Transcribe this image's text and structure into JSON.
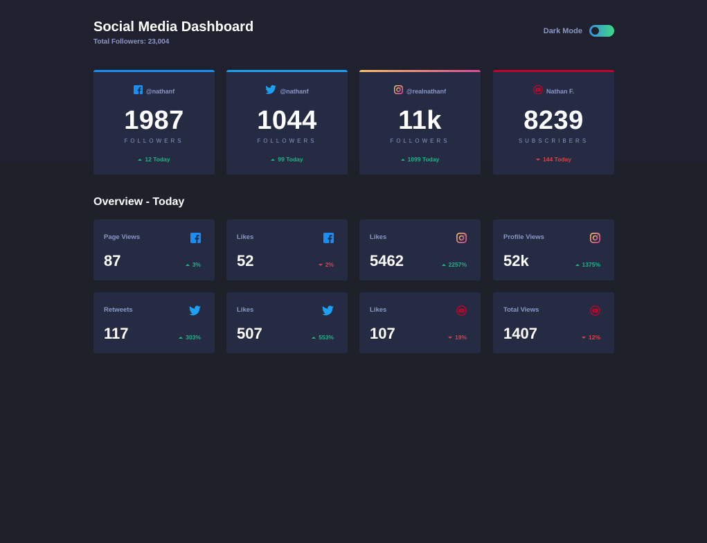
{
  "header": {
    "title": "Social Media Dashboard",
    "subtitle": "Total Followers: 23,004",
    "dark_mode_label": "Dark Mode",
    "dark_mode_on": true
  },
  "colors": {
    "background": "#1e202a",
    "card": "#252b43",
    "text_muted": "#8b97c6",
    "up": "#1eb589",
    "down": "#dc414c",
    "facebook": "#198ff5",
    "twitter": "#1ca0f2",
    "youtube": "#c4032a"
  },
  "cards": [
    {
      "platform": "facebook",
      "icon": "facebook-icon",
      "handle": "@nathanf",
      "count": "1987",
      "unit": "FOLLOWERS",
      "change": "12 Today",
      "trend": "up"
    },
    {
      "platform": "twitter",
      "icon": "twitter-icon",
      "handle": "@nathanf",
      "count": "1044",
      "unit": "FOLLOWERS",
      "change": "99 Today",
      "trend": "up"
    },
    {
      "platform": "instagram",
      "icon": "instagram-icon",
      "handle": "@realnathanf",
      "count": "11k",
      "unit": "FOLLOWERS",
      "change": "1099 Today",
      "trend": "up"
    },
    {
      "platform": "youtube",
      "icon": "youtube-icon",
      "handle": "Nathan F.",
      "count": "8239",
      "unit": "SUBSCRIBERS",
      "change": "144 Today",
      "trend": "down"
    }
  ],
  "overview": {
    "title": "Overview - Today",
    "items": [
      {
        "label": "Page Views",
        "platform": "facebook",
        "value": "87",
        "change": "3%",
        "trend": "up"
      },
      {
        "label": "Likes",
        "platform": "facebook",
        "value": "52",
        "change": "2%",
        "trend": "down"
      },
      {
        "label": "Likes",
        "platform": "instagram",
        "value": "5462",
        "change": "2257%",
        "trend": "up"
      },
      {
        "label": "Profile Views",
        "platform": "instagram",
        "value": "52k",
        "change": "1375%",
        "trend": "up"
      },
      {
        "label": "Retweets",
        "platform": "twitter",
        "value": "117",
        "change": "303%",
        "trend": "up"
      },
      {
        "label": "Likes",
        "platform": "twitter",
        "value": "507",
        "change": "553%",
        "trend": "up"
      },
      {
        "label": "Likes",
        "platform": "youtube",
        "value": "107",
        "change": "19%",
        "trend": "down"
      },
      {
        "label": "Total Views",
        "platform": "youtube",
        "value": "1407",
        "change": "12%",
        "trend": "down"
      }
    ]
  }
}
